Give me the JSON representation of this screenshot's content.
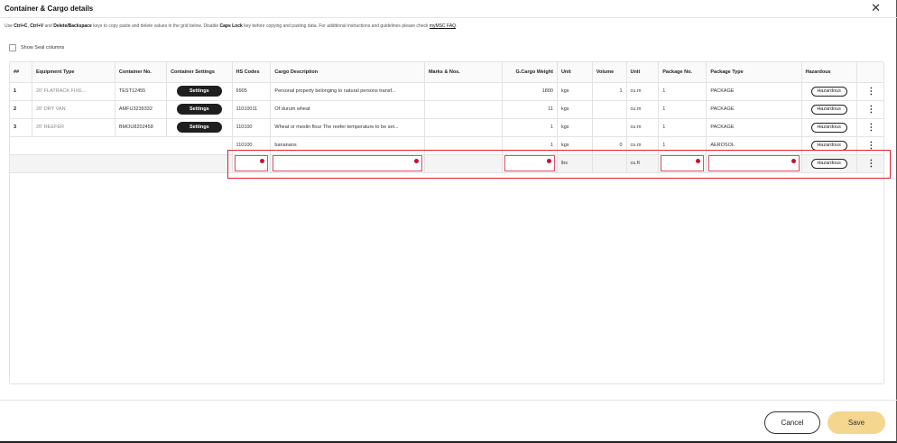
{
  "modal": {
    "title": "Container & Cargo details",
    "close_icon": "✕"
  },
  "instructions": {
    "t1": "Use ",
    "k1": "Ctrl+C",
    "t2": ", ",
    "k2": "Ctrl+V",
    "t3": " and ",
    "k3": "Delete/Backspace",
    "t4": " keys to copy paste and delete values in the grid below. Disable ",
    "k4": "Caps Lock",
    "t5": " key before copying and pasting data. For additional instructions and guidelines please check ",
    "link": "myMSC FAQ",
    "t6": "."
  },
  "seal_toggle": {
    "label": "Show Seal columns",
    "checked": false
  },
  "grid": {
    "headers": {
      "num": "##",
      "equipment": "Equipment Type",
      "container": "Container No.",
      "settings": "Container Settings",
      "hs": "HS Codes",
      "cargo": "Cargo Description",
      "marks": "Marks & Nos.",
      "weight": "G.Cargo Weight",
      "unit1": "Unit",
      "volume": "Volume",
      "unit2": "Unit",
      "pkgno": "Package No.",
      "pkgtype": "Package Type",
      "haz": "Hazardous"
    },
    "settings_label": "Settings",
    "hazardous_label": "Hazardous",
    "rows": [
      {
        "num": "1",
        "equipment": "20' FLATRACK FIXE...",
        "container": "TEST12455",
        "hs": "9905",
        "cargo": "Personal property belonging to natural persons transf...",
        "marks": "",
        "weight": "1800",
        "unit1": "kgs",
        "volume": "1",
        "unit2": "cu.m",
        "pkgno": "1",
        "pkgtype": "PACKAGE"
      },
      {
        "num": "2",
        "equipment": "20' DRY VAN",
        "container": "AMFU3239332",
        "hs": "11010011",
        "cargo": "Of durum wheat",
        "marks": "",
        "weight": "11",
        "unit1": "kgs",
        "volume": "",
        "unit2": "cu.m",
        "pkgno": "1",
        "pkgtype": "PACKAGE"
      },
      {
        "num": "3",
        "equipment": "20' REEFER",
        "container": "BMOU8202458",
        "hs": "110100",
        "cargo": "Wheat or meslin flour The reefer temperature to be set...",
        "marks": "",
        "weight": "1",
        "unit1": "kgs",
        "volume": "",
        "unit2": "cu.m",
        "pkgno": "1",
        "pkgtype": "PACKAGE"
      },
      {
        "hs": "110100",
        "cargo": "bananans",
        "marks": "",
        "weight": "1",
        "unit1": "kgs",
        "volume": "0",
        "unit2": "cu.m",
        "pkgno": "1",
        "pkgtype": "AEROSOL"
      }
    ],
    "new_row": {
      "unit1": "lbs",
      "unit2": "cu.ft"
    }
  },
  "footer": {
    "cancel": "Cancel",
    "save": "Save"
  },
  "colors": {
    "save_bg": "#f4d68e",
    "error": "#c8102e",
    "highlight": "#e0202e"
  }
}
